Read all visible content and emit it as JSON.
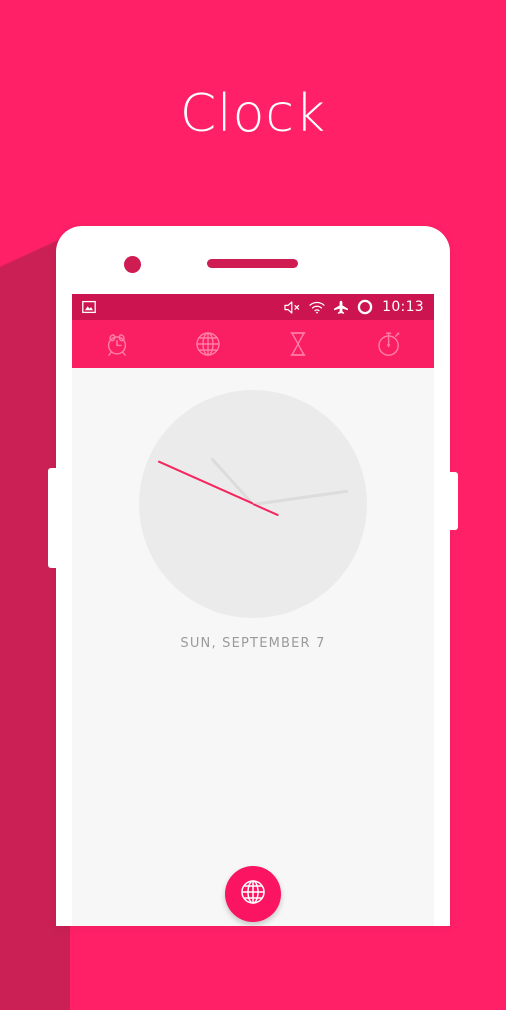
{
  "promo": {
    "title": "Clock",
    "background_color": "#ff2068",
    "shadow_color": "#ca2055"
  },
  "device": {
    "body_color": "#ffffff",
    "accent_color": "#cf1d53",
    "camera_name": "front-camera",
    "speaker_name": "earpiece-speaker"
  },
  "app": {
    "screen_background": "#f7f7f7",
    "status_bar": {
      "background_color": "#cc1450",
      "time": "10:13",
      "left_icons": [
        {
          "name": "screenshot-icon",
          "label": "Screenshot"
        }
      ],
      "right_icons": [
        {
          "name": "volume-mute-icon",
          "label": "Sound off"
        },
        {
          "name": "wifi-icon",
          "label": "Wi-Fi"
        },
        {
          "name": "airplane-mode-icon",
          "label": "Airplane mode"
        },
        {
          "name": "battery-circle-icon",
          "label": "Battery"
        }
      ]
    },
    "tab_bar": {
      "background_color": "#fa1f63",
      "icon_color": "#ff86ad",
      "tabs": [
        {
          "name": "tab-alarm",
          "icon": "alarm-clock-icon",
          "label": "Alarm"
        },
        {
          "name": "tab-world-clock",
          "icon": "globe-icon",
          "label": "World clock"
        },
        {
          "name": "tab-timer",
          "icon": "hourglass-icon",
          "label": "Timer"
        },
        {
          "name": "tab-stopwatch",
          "icon": "stopwatch-icon",
          "label": "Stopwatch"
        }
      ]
    },
    "clock": {
      "face_color": "#ebebeb",
      "hand_color": "#dcdcdc",
      "second_hand_color": "#f4255f",
      "hour_angle_deg": -132,
      "minute_angle_deg": -8,
      "second_angle_deg": 204,
      "time_display": "10:13",
      "date": "SUN, SEPTEMBER 7"
    },
    "fab": {
      "name": "add-world-clock-button",
      "icon": "globe-icon",
      "color": "#fa1461",
      "label": "Add city"
    }
  }
}
